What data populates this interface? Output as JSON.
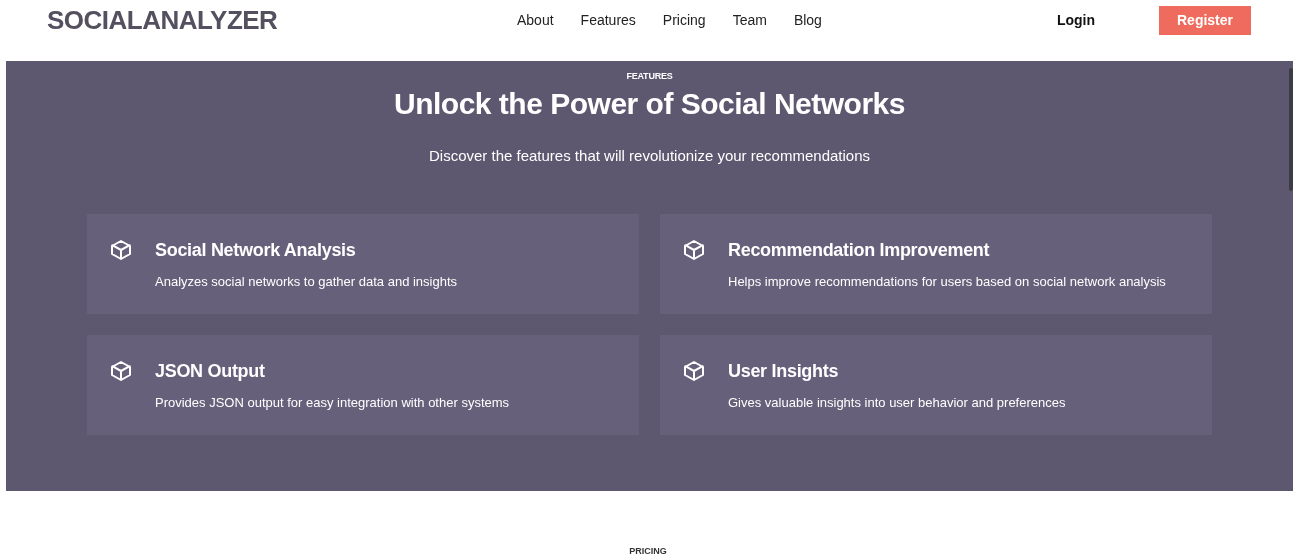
{
  "header": {
    "logo": "SOCIALANALYZER",
    "nav": [
      {
        "label": "About"
      },
      {
        "label": "Features"
      },
      {
        "label": "Pricing"
      },
      {
        "label": "Team"
      },
      {
        "label": "Blog"
      }
    ],
    "login": "Login",
    "register": "Register"
  },
  "features": {
    "eyebrow": "FEATURES",
    "title": "Unlock the Power of Social Networks",
    "subtitle": "Discover the features that will revolutionize your recommendations",
    "cards": [
      {
        "title": "Social Network Analysis",
        "text": "Analyzes social networks to gather data and insights"
      },
      {
        "title": "Recommendation Improvement",
        "text": "Helps improve recommendations for users based on social network analysis"
      },
      {
        "title": "JSON Output",
        "text": "Provides JSON output for easy integration with other systems"
      },
      {
        "title": "User Insights",
        "text": "Gives valuable insights into user behavior and preferences"
      }
    ]
  },
  "pricing": {
    "eyebrow": "PRICING"
  }
}
